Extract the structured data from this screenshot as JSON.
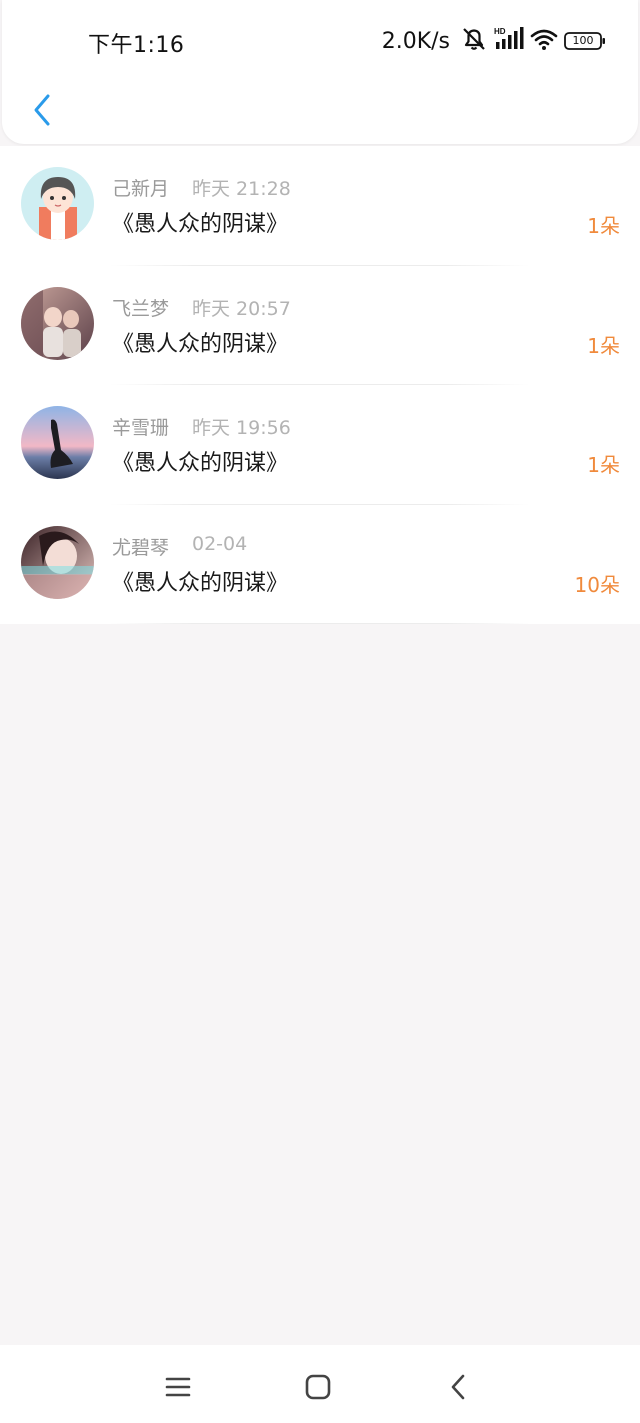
{
  "status_bar": {
    "time": "下午1:16",
    "net_speed": "2.0K/s",
    "battery": "100",
    "icons": [
      "mute-icon",
      "hd-signal-icon",
      "wifi-icon",
      "battery-icon"
    ]
  },
  "header": {
    "back_icon": "chevron-left-icon",
    "accent_color": "#2a9bea"
  },
  "gifts": [
    {
      "name": "己新月",
      "time": "昨天 21:28",
      "title": "《愚人众的阴谋》",
      "count": "1朵"
    },
    {
      "name": "飞兰梦",
      "time": "昨天 20:57",
      "title": "《愚人众的阴谋》",
      "count": "1朵"
    },
    {
      "name": "辛雪珊",
      "time": "昨天 19:56",
      "title": "《愚人众的阴谋》",
      "count": "1朵"
    },
    {
      "name": "尤碧琴",
      "time": "02-04",
      "title": "《愚人众的阴谋》",
      "count": "10朵"
    }
  ],
  "colors": {
    "count": "#f08a3c",
    "name": "#9a9a9a",
    "title": "#1a1a1a",
    "background": "#f7f5f6"
  },
  "nav_bar": {
    "icons": [
      "menu-icon",
      "home-icon",
      "back-icon"
    ]
  }
}
